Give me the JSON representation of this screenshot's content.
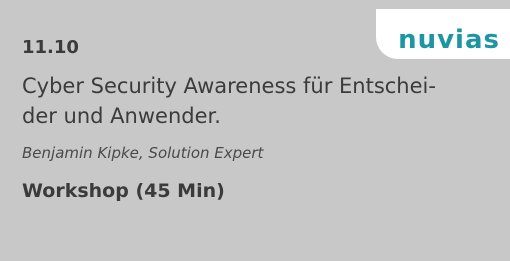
{
  "brand": {
    "logo_text": "nuvias",
    "color": "#1b96a2"
  },
  "session": {
    "date": "11.10",
    "title_line1": "Cyber Security Awareness für Entschei-",
    "title_line2": "der und Anwender.",
    "speaker": "Benjamin Kipke, Solution Expert",
    "format": "Workshop (45 Min)"
  },
  "colors": {
    "card_bg": "#c8c8c8",
    "text": "#3b3b3b"
  }
}
